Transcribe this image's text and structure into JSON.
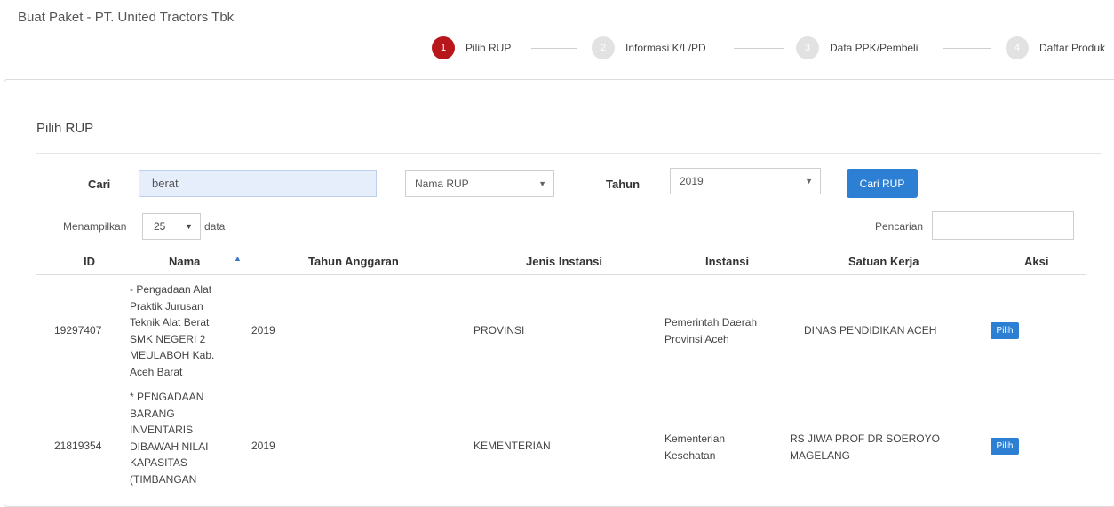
{
  "page": {
    "title": "Buat Paket - PT. United Tractors Tbk"
  },
  "stepper": {
    "steps": [
      {
        "num": "1",
        "label": "Pilih RUP"
      },
      {
        "num": "2",
        "label": "Informasi K/L/PD"
      },
      {
        "num": "3",
        "label": "Data PPK/Pembeli"
      },
      {
        "num": "4",
        "label": "Daftar Produk"
      }
    ],
    "active_color": "#b7161b"
  },
  "form": {
    "section_title": "Pilih RUP",
    "cari_label": "Cari",
    "cari_value": "berat",
    "filter_select": "Nama RUP",
    "tahun_label": "Tahun",
    "tahun_value": "2019",
    "button": "Cari RUP"
  },
  "datatable": {
    "show_label": "Menampilkan",
    "length": "25",
    "data_label": "data",
    "search_label": "Pencarian",
    "search_value": ""
  },
  "table": {
    "headers": {
      "id": "ID",
      "nama": "Nama",
      "tahun": "Tahun Anggaran",
      "jenis": "Jenis Instansi",
      "instansi": "Instansi",
      "satker": "Satuan Kerja",
      "aksi": "Aksi"
    },
    "rows": [
      {
        "id": "19297407",
        "nama": [
          "- Pengadaan Alat",
          "Praktik Jurusan",
          "Teknik Alat Berat",
          "SMK NEGERI 2",
          "MEULABOH Kab.",
          "Aceh Barat"
        ],
        "tahun": "2019",
        "jenis": "PROVINSI",
        "instansi": [
          "Pemerintah Daerah",
          "Provinsi Aceh"
        ],
        "satker": [
          "DINAS PENDIDIKAN ACEH"
        ],
        "aksi": "Pilih"
      },
      {
        "id": "21819354",
        "nama": [
          "* PENGADAAN",
          "BARANG",
          "INVENTARIS",
          "DIBAWAH NILAI",
          "KAPASITAS",
          "(TIMBANGAN"
        ],
        "tahun": "2019",
        "jenis": "KEMENTERIAN",
        "instansi": [
          "Kementerian",
          "Kesehatan"
        ],
        "satker": [
          "RS JIWA PROF DR SOEROYO",
          "MAGELANG"
        ],
        "aksi": "Pilih"
      }
    ]
  }
}
